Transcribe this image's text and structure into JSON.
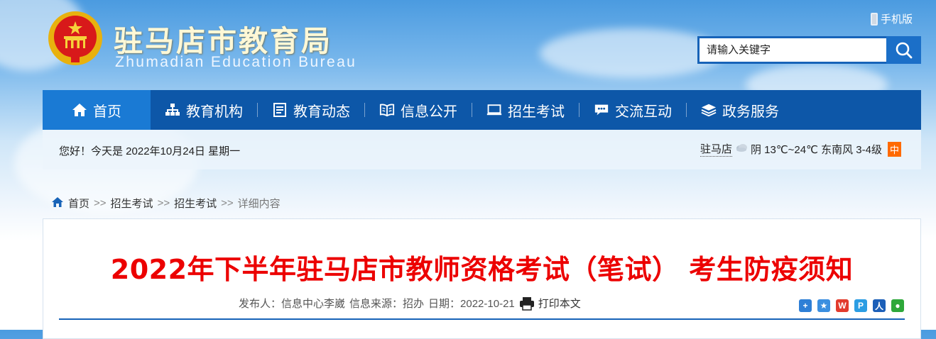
{
  "header": {
    "site_title": "驻马店市教育局",
    "site_subtitle": "Zhumadian Education Bureau",
    "mobile_label": "手机版",
    "search_placeholder": "请输入关键字"
  },
  "nav": {
    "items": [
      {
        "label": "首页",
        "icon": "home-icon"
      },
      {
        "label": "教育机构",
        "icon": "org-chart-icon"
      },
      {
        "label": "教育动态",
        "icon": "news-icon"
      },
      {
        "label": "信息公开",
        "icon": "book-icon"
      },
      {
        "label": "招生考试",
        "icon": "monitor-icon"
      },
      {
        "label": "交流互动",
        "icon": "chat-icon"
      },
      {
        "label": "政务服务",
        "icon": "layers-icon"
      }
    ]
  },
  "infobar": {
    "greeting": "您好！今天是 2022年10月24日 星期一",
    "city": "驻马店",
    "weather": "阴 13℃~24℃ 东南风 3-4级",
    "aqi_badge": "中"
  },
  "breadcrumb": {
    "home": "首页",
    "sep": ">>",
    "level1": "招生考试",
    "level2": "招生考试",
    "current": "详细内容"
  },
  "article": {
    "title": "2022年下半年驻马店市教师资格考试（笔试） 考生防疫须知",
    "publisher": "发布人：信息中心李崴",
    "source": "信息来源：招办",
    "date": "日期：2022-10-21",
    "print_label": "打印本文"
  },
  "colors": {
    "nav_bg": "#0d57a8",
    "nav_active": "#1a7ad4",
    "title_red": "#ec0000",
    "accent_blue": "#1763b8"
  }
}
